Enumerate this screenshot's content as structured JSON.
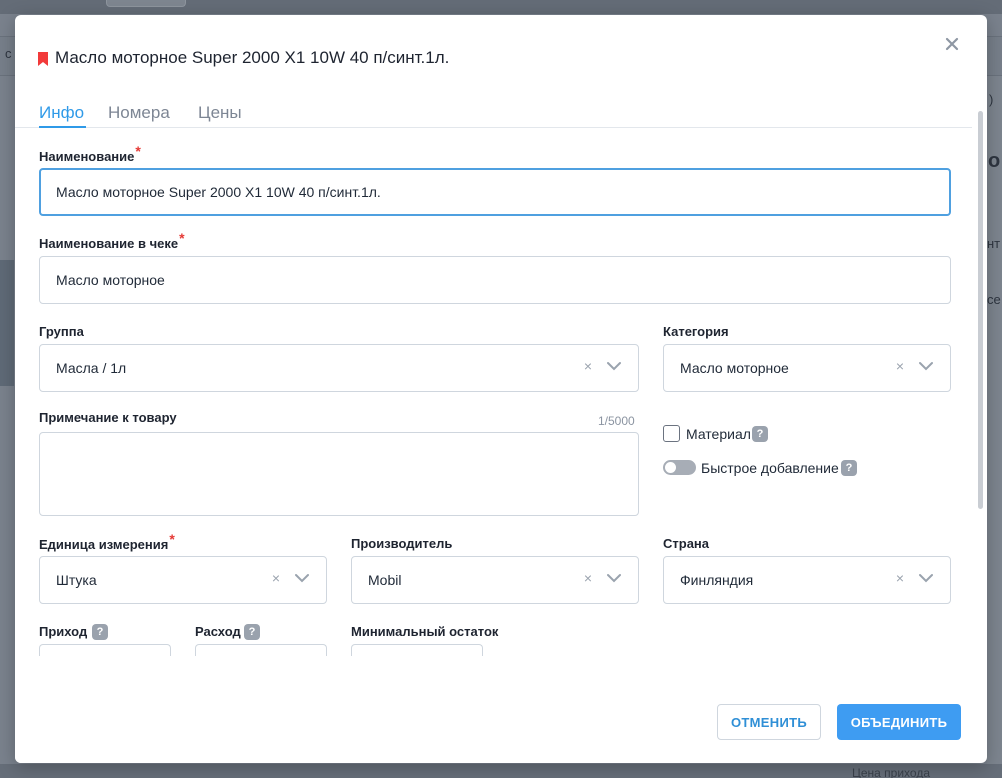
{
  "background": {
    "left_glyph": "с",
    "right_glyph_1": "о",
    "right_glyph_2": "нт",
    "right_glyph_3": "се",
    "right_glyph_4": ")",
    "bottom_text": "Цена прихода"
  },
  "modal": {
    "title": "Масло моторное Super 2000 X1 10W 40 п/синт.1л.",
    "bookmark_color": "#f23a3a",
    "close_icon": "close-icon"
  },
  "tabs": [
    {
      "label": "Инфо",
      "active": true
    },
    {
      "label": "Номера",
      "active": false
    },
    {
      "label": "Цены",
      "active": false
    }
  ],
  "form": {
    "name": {
      "label": "Наименование",
      "required": "*",
      "value": "Масло моторное Super 2000 X1 10W 40 п/синт.1л."
    },
    "receipt_name": {
      "label": "Наименование в чеке",
      "required": "*",
      "value": "Масло моторное"
    },
    "group": {
      "label": "Группа",
      "value": "Масла / 1л"
    },
    "category": {
      "label": "Категория",
      "value": "Масло моторное"
    },
    "note": {
      "label": "Примечание к товару",
      "counter": "1/5000",
      "value": ""
    },
    "material": {
      "label": "Материал",
      "checked": false,
      "help": "?"
    },
    "quick_add": {
      "label": "Быстрое добавление",
      "enabled": false,
      "help": "?"
    },
    "unit": {
      "label": "Единица измерения",
      "required": "*",
      "value": "Штука"
    },
    "manufacturer": {
      "label": "Производитель",
      "value": "Mobil"
    },
    "country": {
      "label": "Страна",
      "value": "Финляндия"
    },
    "income": {
      "label": "Приход",
      "help": "?"
    },
    "expense": {
      "label": "Расход",
      "help": "?"
    },
    "min_stock": {
      "label": "Минимальный остаток"
    }
  },
  "clear_glyph": "×",
  "buttons": {
    "cancel": "ОТМЕНИТЬ",
    "merge": "ОБЪЕДИНИТЬ"
  },
  "colors": {
    "accent": "#2f9ae8",
    "primary_button": "#3e9cf2",
    "required": "#e53935"
  }
}
